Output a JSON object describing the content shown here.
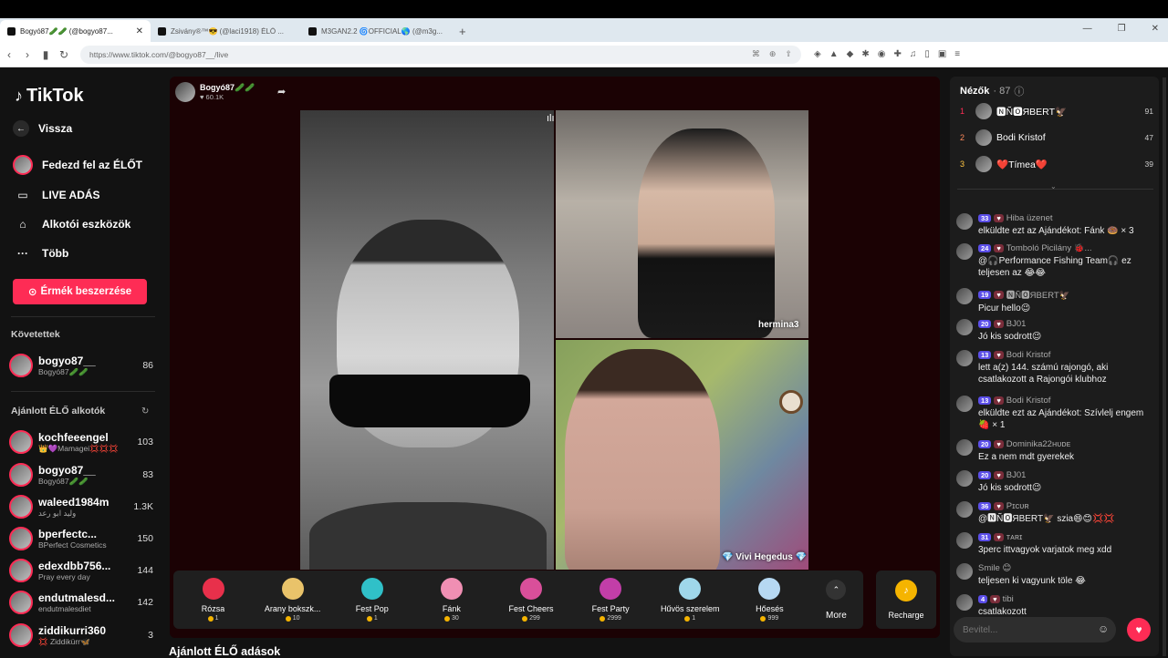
{
  "browser": {
    "tabs": [
      {
        "title": "Bogyó87🥒🥒 (@bogyo87...",
        "active": true
      },
      {
        "title": "Zsivány®™😎 (@laci1918) ÉLŐ ...",
        "active": false
      },
      {
        "title": "M3GAN2.2 🌀OFFICIAL🌎 (@m3g...",
        "active": false
      }
    ],
    "url": "https://www.tiktok.com/@bogyo87__/live",
    "new_tab": "+",
    "win_min": "—",
    "win_max": "❐",
    "win_close": "✕"
  },
  "sidebar": {
    "logo": "TikTok",
    "back": "Vissza",
    "explore": "Fedezd fel az ÉLŐT",
    "live": "LIVE ADÁS",
    "tools": "Alkotói eszközök",
    "more": "Több",
    "coins_button": "Érmék beszerzése",
    "following_title": "Követettek",
    "following": [
      {
        "user": "bogyo87__",
        "sub": "Bogyó87🥒🥒",
        "count": "86"
      }
    ],
    "recommended_title": "Ajánlott ÉLŐ alkotók",
    "recommended": [
      {
        "user": "kochfeeengel",
        "sub": "👑💜Mamagei💢💢💢",
        "count": "103"
      },
      {
        "user": "bogyo87__",
        "sub": "Bogyó87🥒🥒",
        "count": "83"
      },
      {
        "user": "waleed1984m",
        "sub": "وليد ابو رعد",
        "count": "1.3K"
      },
      {
        "user": "bperfectc...",
        "sub": "BPerfect Cosmetics",
        "count": "150"
      },
      {
        "user": "edexdbb756...",
        "sub": "Pray every day",
        "count": "144"
      },
      {
        "user": "endutmalesd...",
        "sub": "endutmalesdiet",
        "count": "142"
      },
      {
        "user": "ziddikurri360",
        "sub": "💢 Ziddikürr🦋",
        "count": "3"
      }
    ],
    "rec_live_title": "Ajánlott ÉLŐ adások"
  },
  "stream": {
    "host_name": "Bogyó87🥒🥒",
    "host_likes": "♥ 60.1K",
    "guest1": "hermina3",
    "guest2": "💎 Vivi Hegedus 💎",
    "gifts": [
      {
        "name": "Rózsa",
        "price": "1",
        "color": "#e8304b"
      },
      {
        "name": "Arany bokszk...",
        "price": "10",
        "color": "#e9c36a"
      },
      {
        "name": "Fest Pop",
        "price": "1",
        "color": "#30c0c8"
      },
      {
        "name": "Fánk",
        "price": "30",
        "color": "#f08fb3"
      },
      {
        "name": "Fest Cheers",
        "price": "299",
        "color": "#d94f9a"
      },
      {
        "name": "Fest Party",
        "price": "2999",
        "color": "#c23ea8"
      },
      {
        "name": "Hűvös szerelem",
        "price": "1",
        "color": "#9fd7ea"
      },
      {
        "name": "Hőesés",
        "price": "999",
        "color": "#b6d8f2"
      }
    ],
    "more_label": "More",
    "recharge_label": "Recharge"
  },
  "panel": {
    "viewers_label": "Nézők",
    "viewers_count": "· 87",
    "top_viewers": [
      {
        "rank": "1",
        "name": "🅽Ñ🅾ЯBERT🦅",
        "score": "91"
      },
      {
        "rank": "2",
        "name": "Bodi Kristof",
        "score": "47"
      },
      {
        "rank": "3",
        "name": "❤️Tímea❤️",
        "score": "39"
      }
    ],
    "messages": [
      {
        "level": "33",
        "name": "Hiba üzenet",
        "text": "elküldte ezt az Ajándékot: Fánk 🍩 × 3"
      },
      {
        "level": "24",
        "name": "Tomboló Picilány 🐞...",
        "text": "@🎧Performance Fishing Team🎧 ez teljesen az 😂😂"
      },
      {
        "level": "19",
        "name": "🅽Ñ🅾ЯBERT🦅",
        "text": "Picur hello😉"
      },
      {
        "level": "20",
        "name": "BJ01",
        "text": "Jó kis sodrott😉"
      },
      {
        "level": "13",
        "name": "Bodi Kristof",
        "text": "lett a(z) 144. számú rajongó, aki csatlakozott a Rajongói klubhoz"
      },
      {
        "level": "13",
        "name": "Bodi Kristof",
        "text": "elküldte ezt az Ajándékot: Szívlelj engem🍓 × 1"
      },
      {
        "level": "20",
        "name": "Dominika22ʜᴜᴅᴇ",
        "text": "Ez a nem mdt gyerekek"
      },
      {
        "level": "20",
        "name": "BJ01",
        "text": "Jó kis sodrott😉"
      },
      {
        "level": "36",
        "name": "Pɪᴄᴜʀ",
        "text": "@🅽Ñ🅾ЯBERT🦅 szia😄😊💢💢"
      },
      {
        "level": "31",
        "name": "ᴛᴀʀɪ",
        "text": "3perc ittvagyok varjatok meg xdd"
      },
      {
        "level": "",
        "name": "Smile 😊",
        "text": "teljesen ki vagyunk töle 😂"
      },
      {
        "level": "4",
        "name": "tibi",
        "text": "csatlakozott"
      }
    ],
    "input_placeholder": "Bevitel..."
  }
}
